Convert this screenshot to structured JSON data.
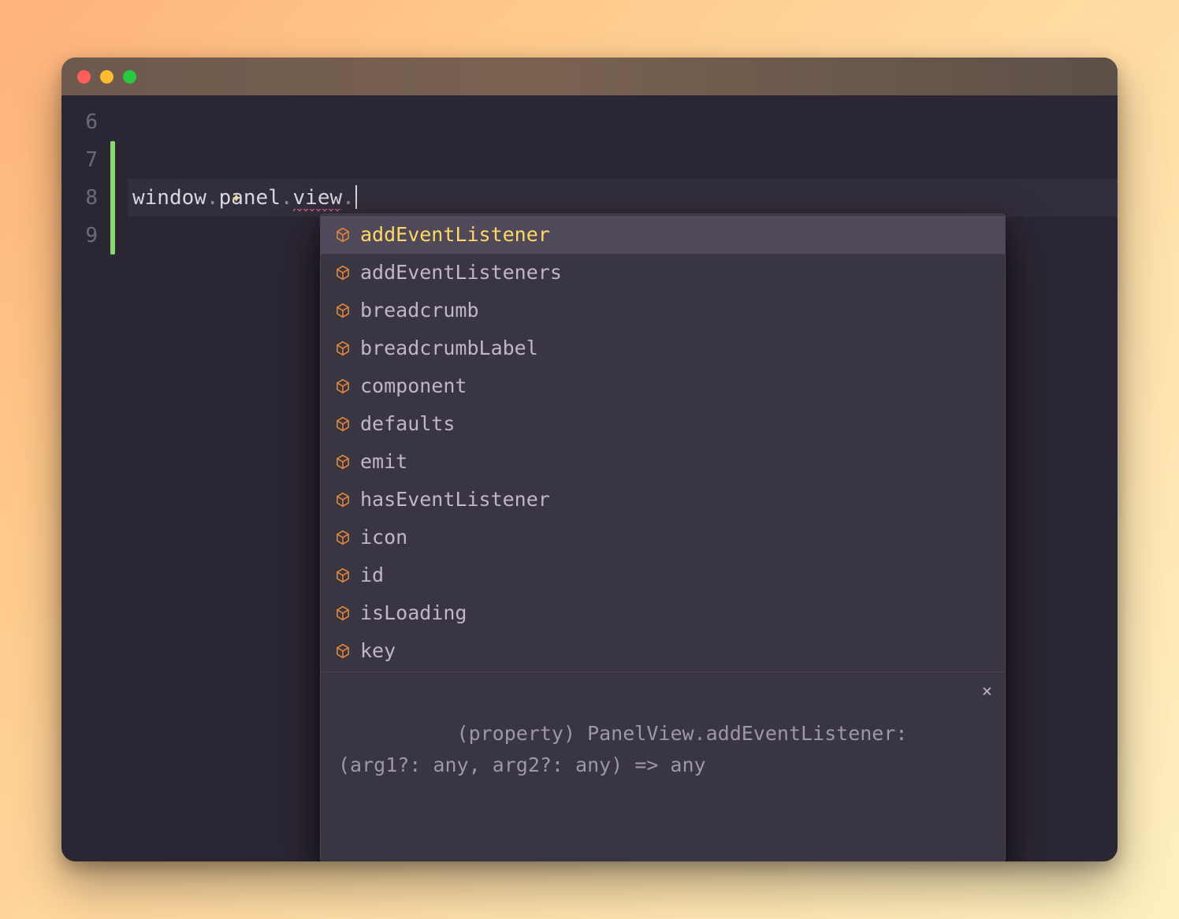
{
  "gutter": {
    "lines": [
      "6",
      "7",
      "8",
      "9"
    ]
  },
  "code": {
    "line8": {
      "seg1": "window",
      "dot1": ".",
      "seg2": "panel",
      "dot2": ".",
      "seg3": "view",
      "dot3": "."
    }
  },
  "autocomplete": {
    "items": [
      {
        "label": "addEventListener",
        "selected": true
      },
      {
        "label": "addEventListeners",
        "selected": false
      },
      {
        "label": "breadcrumb",
        "selected": false
      },
      {
        "label": "breadcrumbLabel",
        "selected": false
      },
      {
        "label": "component",
        "selected": false
      },
      {
        "label": "defaults",
        "selected": false
      },
      {
        "label": "emit",
        "selected": false
      },
      {
        "label": "hasEventListener",
        "selected": false
      },
      {
        "label": "icon",
        "selected": false
      },
      {
        "label": "id",
        "selected": false
      },
      {
        "label": "isLoading",
        "selected": false
      },
      {
        "label": "key",
        "selected": false
      }
    ],
    "detail": "(property) PanelView.addEventListener: (arg1?: any, arg2?: any) => any",
    "close_symbol": "×"
  }
}
